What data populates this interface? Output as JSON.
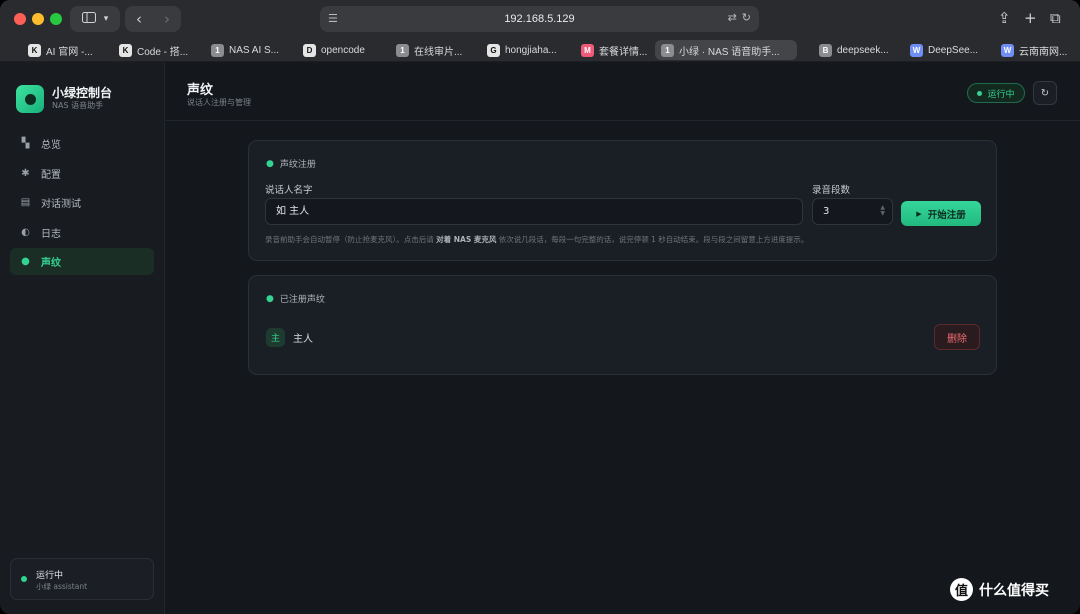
{
  "browser": {
    "address": "192.168.5.129",
    "tabs": [
      {
        "favicon": "K",
        "label": "AI 官网 -...",
        "style": "white"
      },
      {
        "favicon": "K",
        "label": "Code - 搭...",
        "style": "white"
      },
      {
        "favicon": "1",
        "label": "NAS AI S...",
        "style": "gray"
      },
      {
        "favicon": "D",
        "label": "opencode",
        "style": "white"
      },
      {
        "favicon": "1",
        "label": "在线审片...",
        "style": "gray"
      },
      {
        "favicon": "G",
        "label": "hongjiaha...",
        "style": "white"
      },
      {
        "favicon": "M",
        "label": "套餐详情...",
        "style": "pink"
      },
      {
        "favicon": "1",
        "label": "小绿 · NAS 语音助手...",
        "style": "gray",
        "active": true
      },
      {
        "favicon": "B",
        "label": "deepseek...",
        "style": "gray"
      },
      {
        "favicon": "W",
        "label": "DeepSee...",
        "style": "blue"
      },
      {
        "favicon": "W",
        "label": "云南南网...",
        "style": "blue"
      }
    ]
  },
  "sidebar": {
    "brand_title": "小绿控制台",
    "brand_subtitle": "NAS 语音助手",
    "items": [
      {
        "label": "总览",
        "icon": "grid-icon"
      },
      {
        "label": "配置",
        "icon": "gear-icon"
      },
      {
        "label": "对话测试",
        "icon": "chat-icon"
      },
      {
        "label": "日志",
        "icon": "half-circle-icon"
      },
      {
        "label": "声纹",
        "icon": "voiceprint-icon",
        "active": true
      }
    ],
    "status_title": "运行中",
    "status_sub": "小绿 assistant"
  },
  "header": {
    "title": "声纹",
    "subtitle": "说话人注册与管理",
    "status_badge": "运行中"
  },
  "register_card": {
    "heading": "声纹注册",
    "name_label": "说话人名字",
    "name_placeholder": "如 主人",
    "segments_label": "录音段数",
    "segments_value": "3",
    "start_button": "开始注册",
    "hint_part1": "录音前助手会自动暂停（防止抢麦克风）。点击后请 ",
    "hint_bold": "对着 NAS 麦克风",
    "hint_part2": " 依次说几段话，每段一句完整的话，说完停顿 1 秒自动结束。段与段之间留意上方进度提示。"
  },
  "registered_card": {
    "heading": "已注册声纹",
    "items": [
      {
        "avatar": "主",
        "name": "主人",
        "delete_label": "删除"
      }
    ]
  },
  "watermark": {
    "logo": "值",
    "text": "什么值得买"
  },
  "colors": {
    "accent": "#35d392",
    "danger": "#ef6c72",
    "background": "#14171c"
  }
}
